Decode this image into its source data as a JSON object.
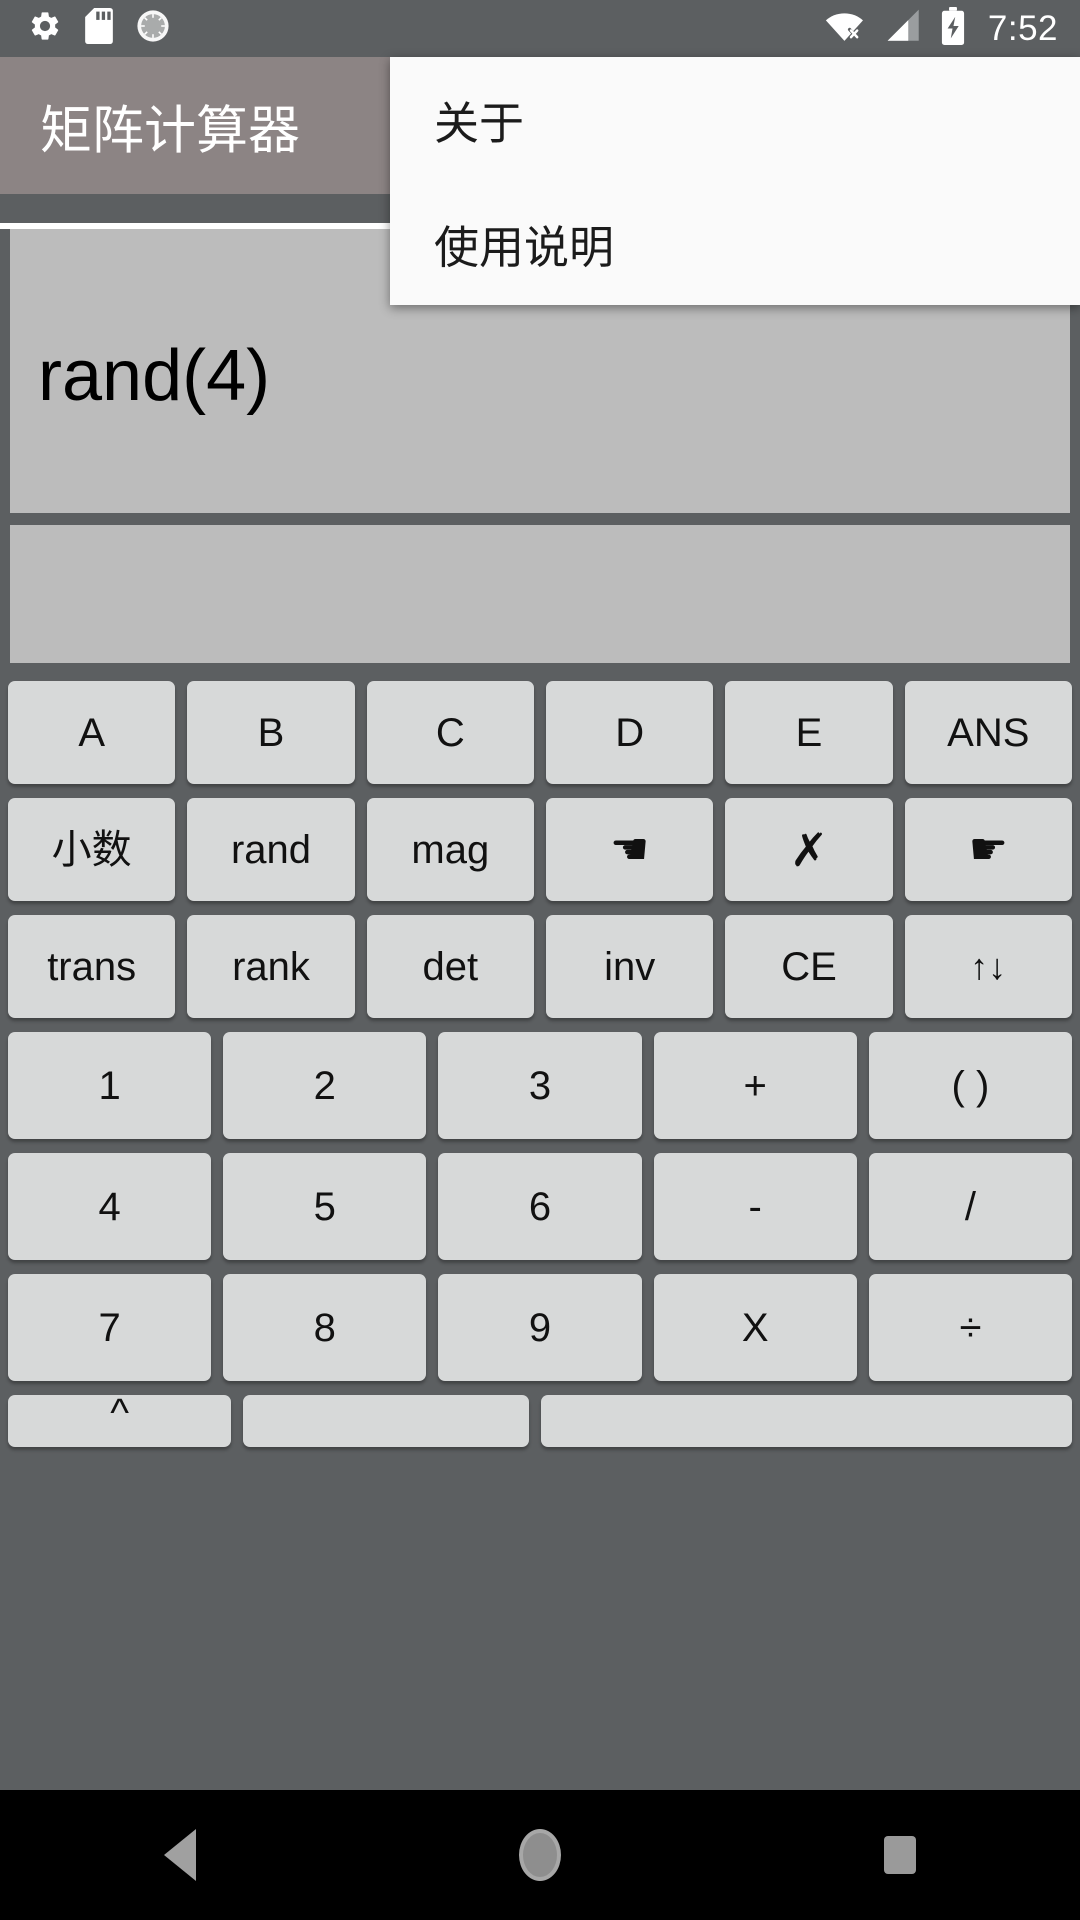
{
  "statusbar": {
    "icons_left": [
      "gear-icon",
      "sd-card-icon",
      "sync-circle-icon"
    ],
    "icons_right": [
      "wifi-off-icon",
      "cellular-signal-icon",
      "battery-charging-icon"
    ],
    "time": "7:52"
  },
  "appbar": {
    "title": "矩阵计算器"
  },
  "menu": {
    "items": [
      {
        "label": "关于"
      },
      {
        "label": "使用说明"
      }
    ]
  },
  "display": {
    "expression": "rand(4)",
    "result": ""
  },
  "keypad": {
    "rows": [
      {
        "type": "six",
        "keys": [
          {
            "label": "A",
            "name": "key-matrix-a"
          },
          {
            "label": "B",
            "name": "key-matrix-b"
          },
          {
            "label": "C",
            "name": "key-matrix-c"
          },
          {
            "label": "D",
            "name": "key-matrix-d"
          },
          {
            "label": "E",
            "name": "key-matrix-e"
          },
          {
            "label": "ANS",
            "name": "key-ans"
          }
        ]
      },
      {
        "type": "six",
        "keys": [
          {
            "label": "小数",
            "name": "key-decimal",
            "style": "cjk"
          },
          {
            "label": "rand",
            "name": "key-rand"
          },
          {
            "label": "mag",
            "name": "key-mag"
          },
          {
            "label": "☚",
            "name": "key-cursor-left",
            "style": "hand"
          },
          {
            "label": "✗",
            "name": "key-delete",
            "style": "cross"
          },
          {
            "label": "☛",
            "name": "key-cursor-right",
            "style": "hand"
          }
        ]
      },
      {
        "type": "six",
        "keys": [
          {
            "label": "trans",
            "name": "key-transpose"
          },
          {
            "label": "rank",
            "name": "key-rank"
          },
          {
            "label": "det",
            "name": "key-determinant"
          },
          {
            "label": "inv",
            "name": "key-inverse"
          },
          {
            "label": "CE",
            "name": "key-clear-entry"
          },
          {
            "label": "↑↓",
            "name": "key-scroll",
            "style": "arrows"
          }
        ]
      },
      {
        "type": "five",
        "keys": [
          {
            "label": "1",
            "name": "key-1"
          },
          {
            "label": "2",
            "name": "key-2"
          },
          {
            "label": "3",
            "name": "key-3"
          },
          {
            "label": "+",
            "name": "key-plus"
          },
          {
            "label": "( )",
            "name": "key-parentheses"
          }
        ]
      },
      {
        "type": "five",
        "keys": [
          {
            "label": "4",
            "name": "key-4"
          },
          {
            "label": "5",
            "name": "key-5"
          },
          {
            "label": "6",
            "name": "key-6"
          },
          {
            "label": "-",
            "name": "key-minus"
          },
          {
            "label": "/",
            "name": "key-slash"
          }
        ]
      },
      {
        "type": "five",
        "keys": [
          {
            "label": "7",
            "name": "key-7"
          },
          {
            "label": "8",
            "name": "key-8"
          },
          {
            "label": "9",
            "name": "key-9"
          },
          {
            "label": "X",
            "name": "key-multiply"
          },
          {
            "label": "÷",
            "name": "key-divide"
          }
        ]
      },
      {
        "type": "partial",
        "keys": [
          {
            "label": "^",
            "name": "key-power"
          },
          {
            "label": "",
            "name": "key-blank-1"
          },
          {
            "label": "",
            "name": "key-blank-2"
          }
        ]
      }
    ]
  },
  "navbar": {
    "back": "back-triangle-icon",
    "home": "home-circle-icon",
    "recents": "recents-square-icon"
  },
  "colors": {
    "status_bar": "#5c5f61",
    "app_bar": "#8c8484",
    "keypad_bg": "#5c5f61",
    "key_face": "#d7d9d9",
    "display_panel": "#bcbcbc",
    "menu_bg": "#fafafa",
    "nav_bar": "#000000"
  }
}
